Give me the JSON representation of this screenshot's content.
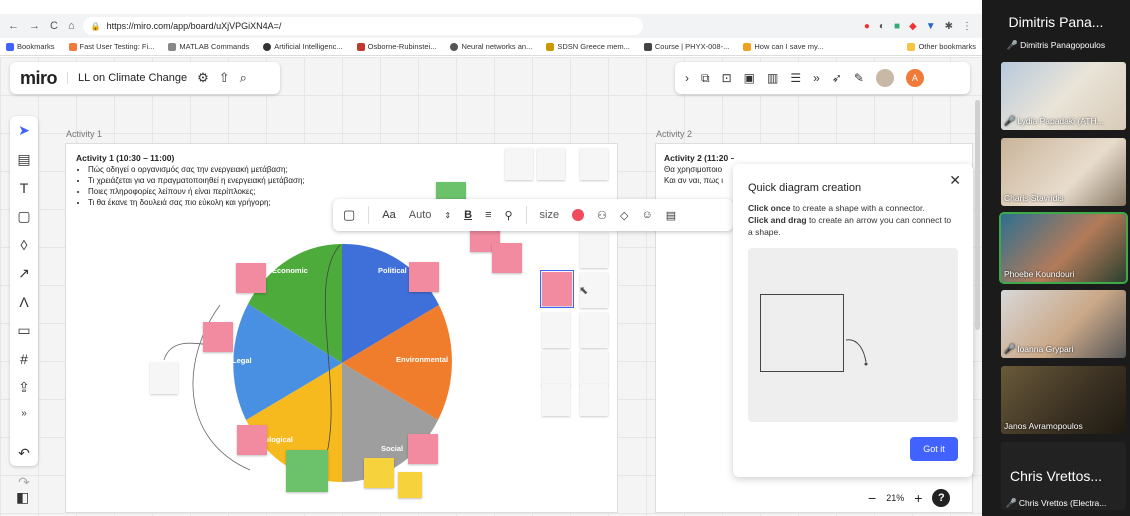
{
  "browser": {
    "url": "https://miro.com/app/board/uXjVPGiXN4A=/",
    "nav": [
      "←",
      "→",
      "C",
      "⌂"
    ],
    "bookmarks": [
      "Bookmarks",
      "Fast User Testing: Fi...",
      "MATLAB Commands",
      "Artificial Intelligenc...",
      "Osborne-Rubinstei...",
      "Neural networks an...",
      "SDSN Greece mem...",
      "Course | PHYX-008-...",
      "How can I save my...",
      "Other bookmarks"
    ]
  },
  "miro": {
    "logo": "miro",
    "board_name": "LL on Climate Change",
    "frame1_title": "Activity 1",
    "frame2_title": "Activity 2",
    "activity1": {
      "heading": "Activity 1 (10:30 – 11:00)",
      "bullets": [
        "Πώς οδηγεί ο οργανισμός σας την ενεργειακή μετάβαση;",
        "Τι χρειάζεται για να πραγματοποιηθεί η ενεργειακή μετάβαση;",
        "Ποιες πληροφορίες λείπουν ή είναι περίπλοκες;",
        "Τι θα έκανε τη δουλειά σας πιο εύκολη και γρήγορη;"
      ]
    },
    "activity2": {
      "heading": "Activity 2 (11:20 – 11:50)",
      "line1": "Θα χρησιμοποιο",
      "line2": "Και αν ναι, πως ι"
    },
    "pie_labels": [
      "Economic",
      "Political",
      "Environmental",
      "Social",
      "Technological",
      "Legal"
    ],
    "toolbar": {
      "font": "Aa",
      "font_size": "Auto",
      "bold": "B",
      "size_label": "size"
    },
    "panel": {
      "title": "Quick diagram creation",
      "click_once_bold": "Click once",
      "click_once_text": " to create a shape with a connector.",
      "click_drag_bold": "Click and drag",
      "click_drag_text": " to create an arrow you can connect to a shape.",
      "button": "Got it"
    },
    "zoom": "21%",
    "zoom_minus": "−",
    "zoom_plus": "+",
    "help": "?",
    "user_avatar": "A"
  },
  "call": {
    "presenter_short": "Dimitris Pana...",
    "presenter_full": "Dimitris Panagopoulos",
    "participants": [
      "Lydia Papadaki (ATH...",
      "Charis Stavridis",
      "Phoebe Koundouri",
      "Ioanna Grypari",
      "Janos Avramopoulos"
    ],
    "bottom_short": "Chris Vrettos...",
    "bottom_full": "Chris Vrettos (Electra..."
  }
}
